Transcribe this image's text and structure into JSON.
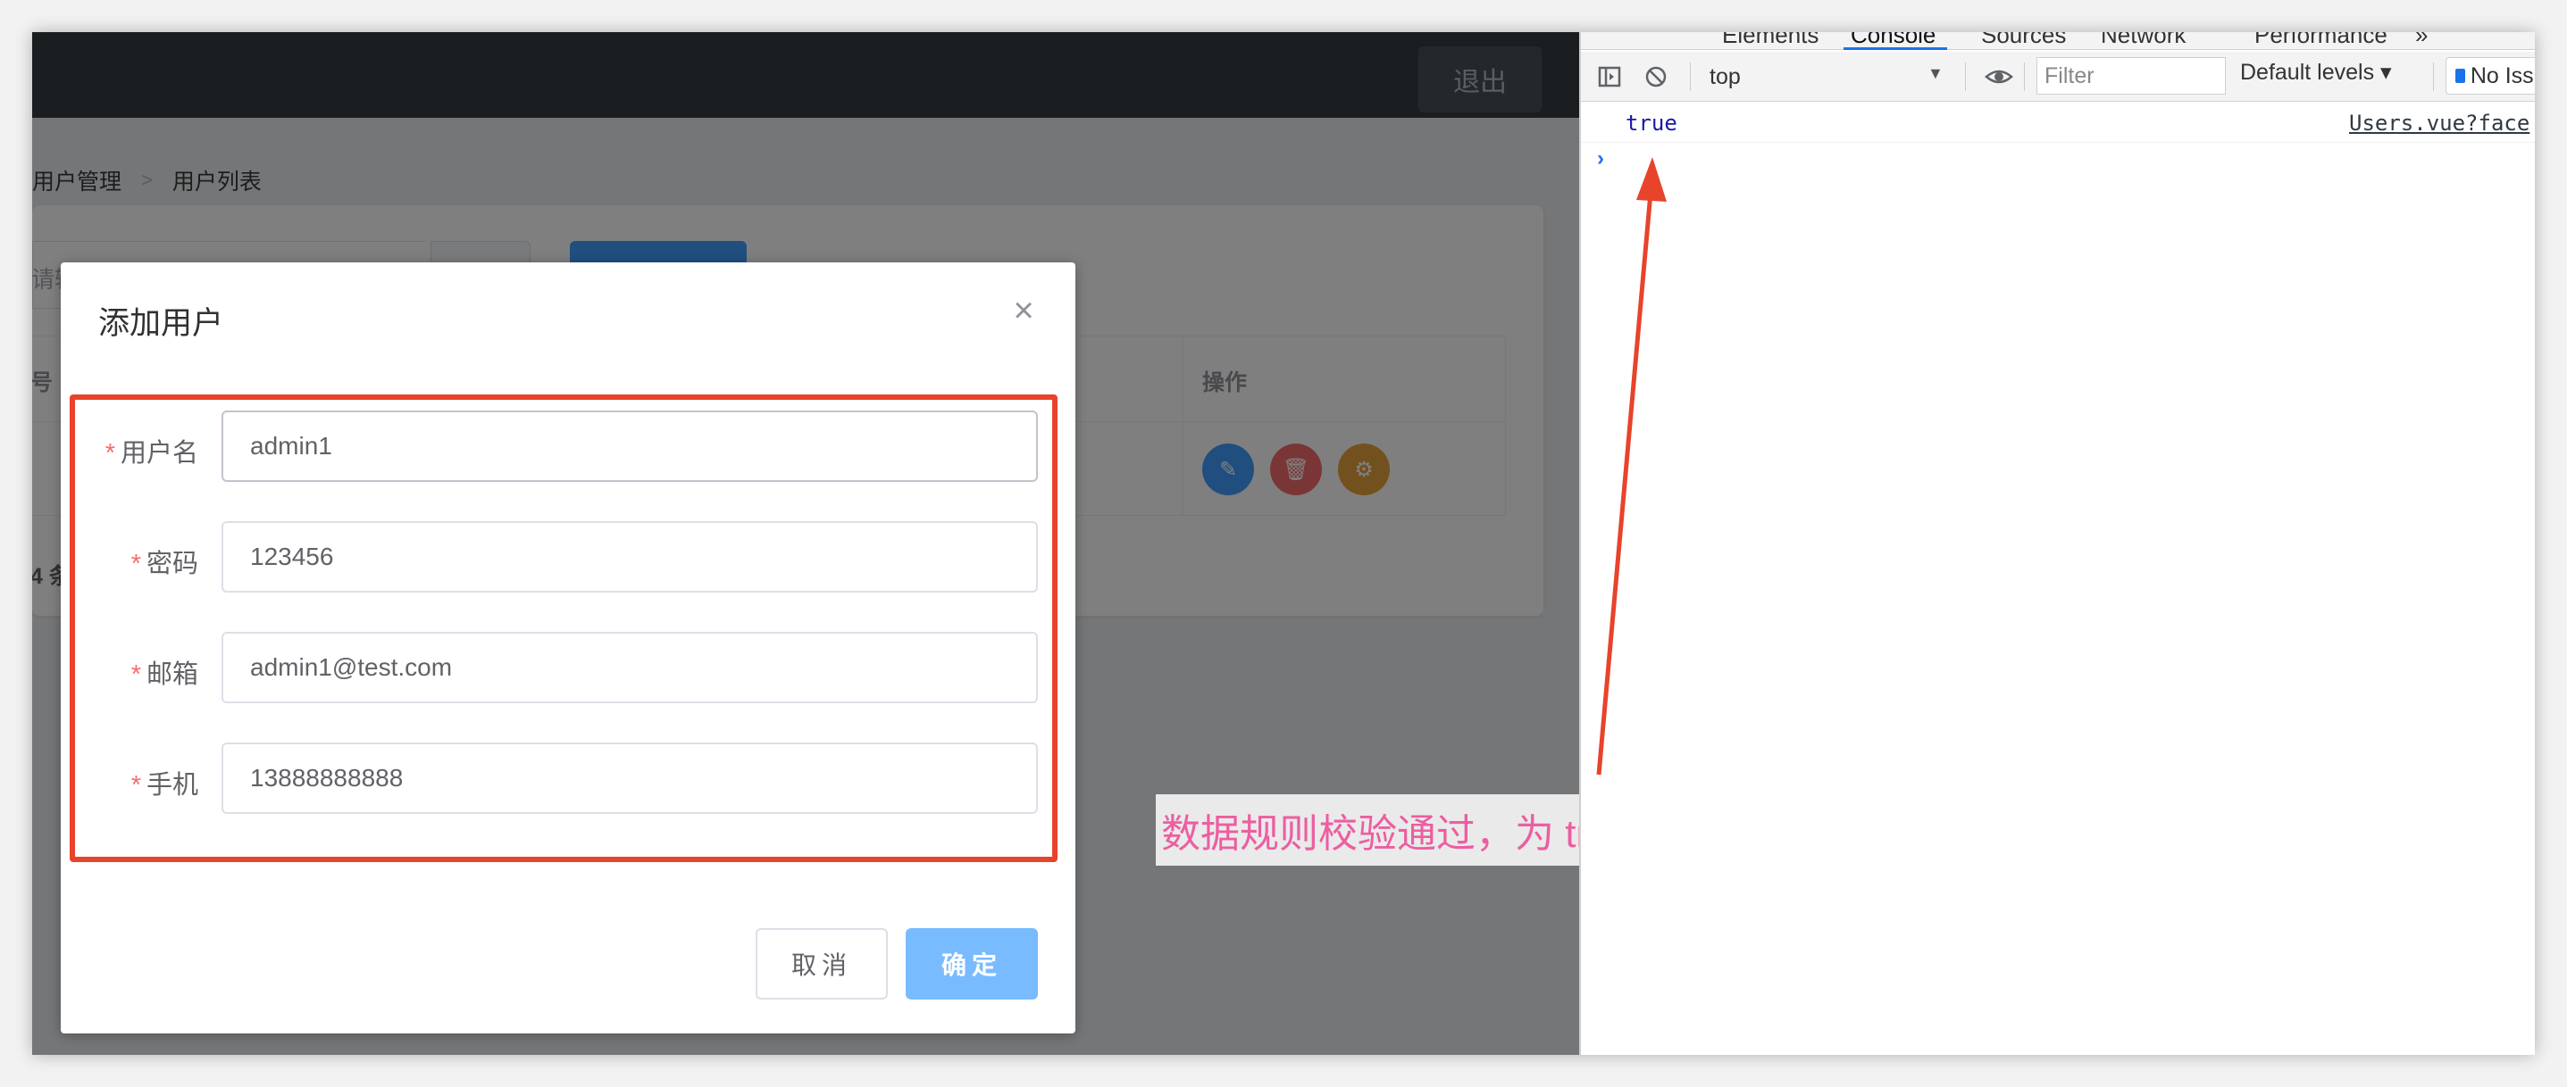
{
  "app": {
    "logout_label": "退出",
    "breadcrumb": [
      "用户管理",
      "用户列表"
    ],
    "search_placeholder": "请输",
    "table": {
      "index_header": "号",
      "ops_header": "操作"
    },
    "total_text": "4 条"
  },
  "dialog": {
    "title": "添加用户",
    "close_icon": "close-icon",
    "fields": {
      "username": {
        "label": "用户名",
        "value": "admin1",
        "required": "*"
      },
      "password": {
        "label": "密码",
        "value": "123456",
        "required": "*"
      },
      "email": {
        "label": "邮箱",
        "value": "admin1@test.com",
        "required": "*"
      },
      "mobile": {
        "label": "手机",
        "value": "13888888888",
        "required": "*"
      }
    },
    "cancel_label": "取消",
    "confirm_label": "确定"
  },
  "annotation": {
    "text": "数据规则校验通过，为 true",
    "color": "#ec5ea0",
    "highlight_color": "#e8432b"
  },
  "devtools": {
    "tabs": [
      "Elements",
      "Console",
      "Sources",
      "Network",
      "Performance",
      "»"
    ],
    "active_tab": "Console",
    "context": "top",
    "filter_placeholder": "Filter",
    "levels": "Default levels ▾",
    "issues": "No Issues",
    "console_value": "true",
    "console_source": "Users.vue?face",
    "prompt": "›"
  },
  "colors": {
    "primary": "#409eff",
    "danger": "#f56c6c",
    "warning": "#e6a23c",
    "header": "#373d41"
  }
}
